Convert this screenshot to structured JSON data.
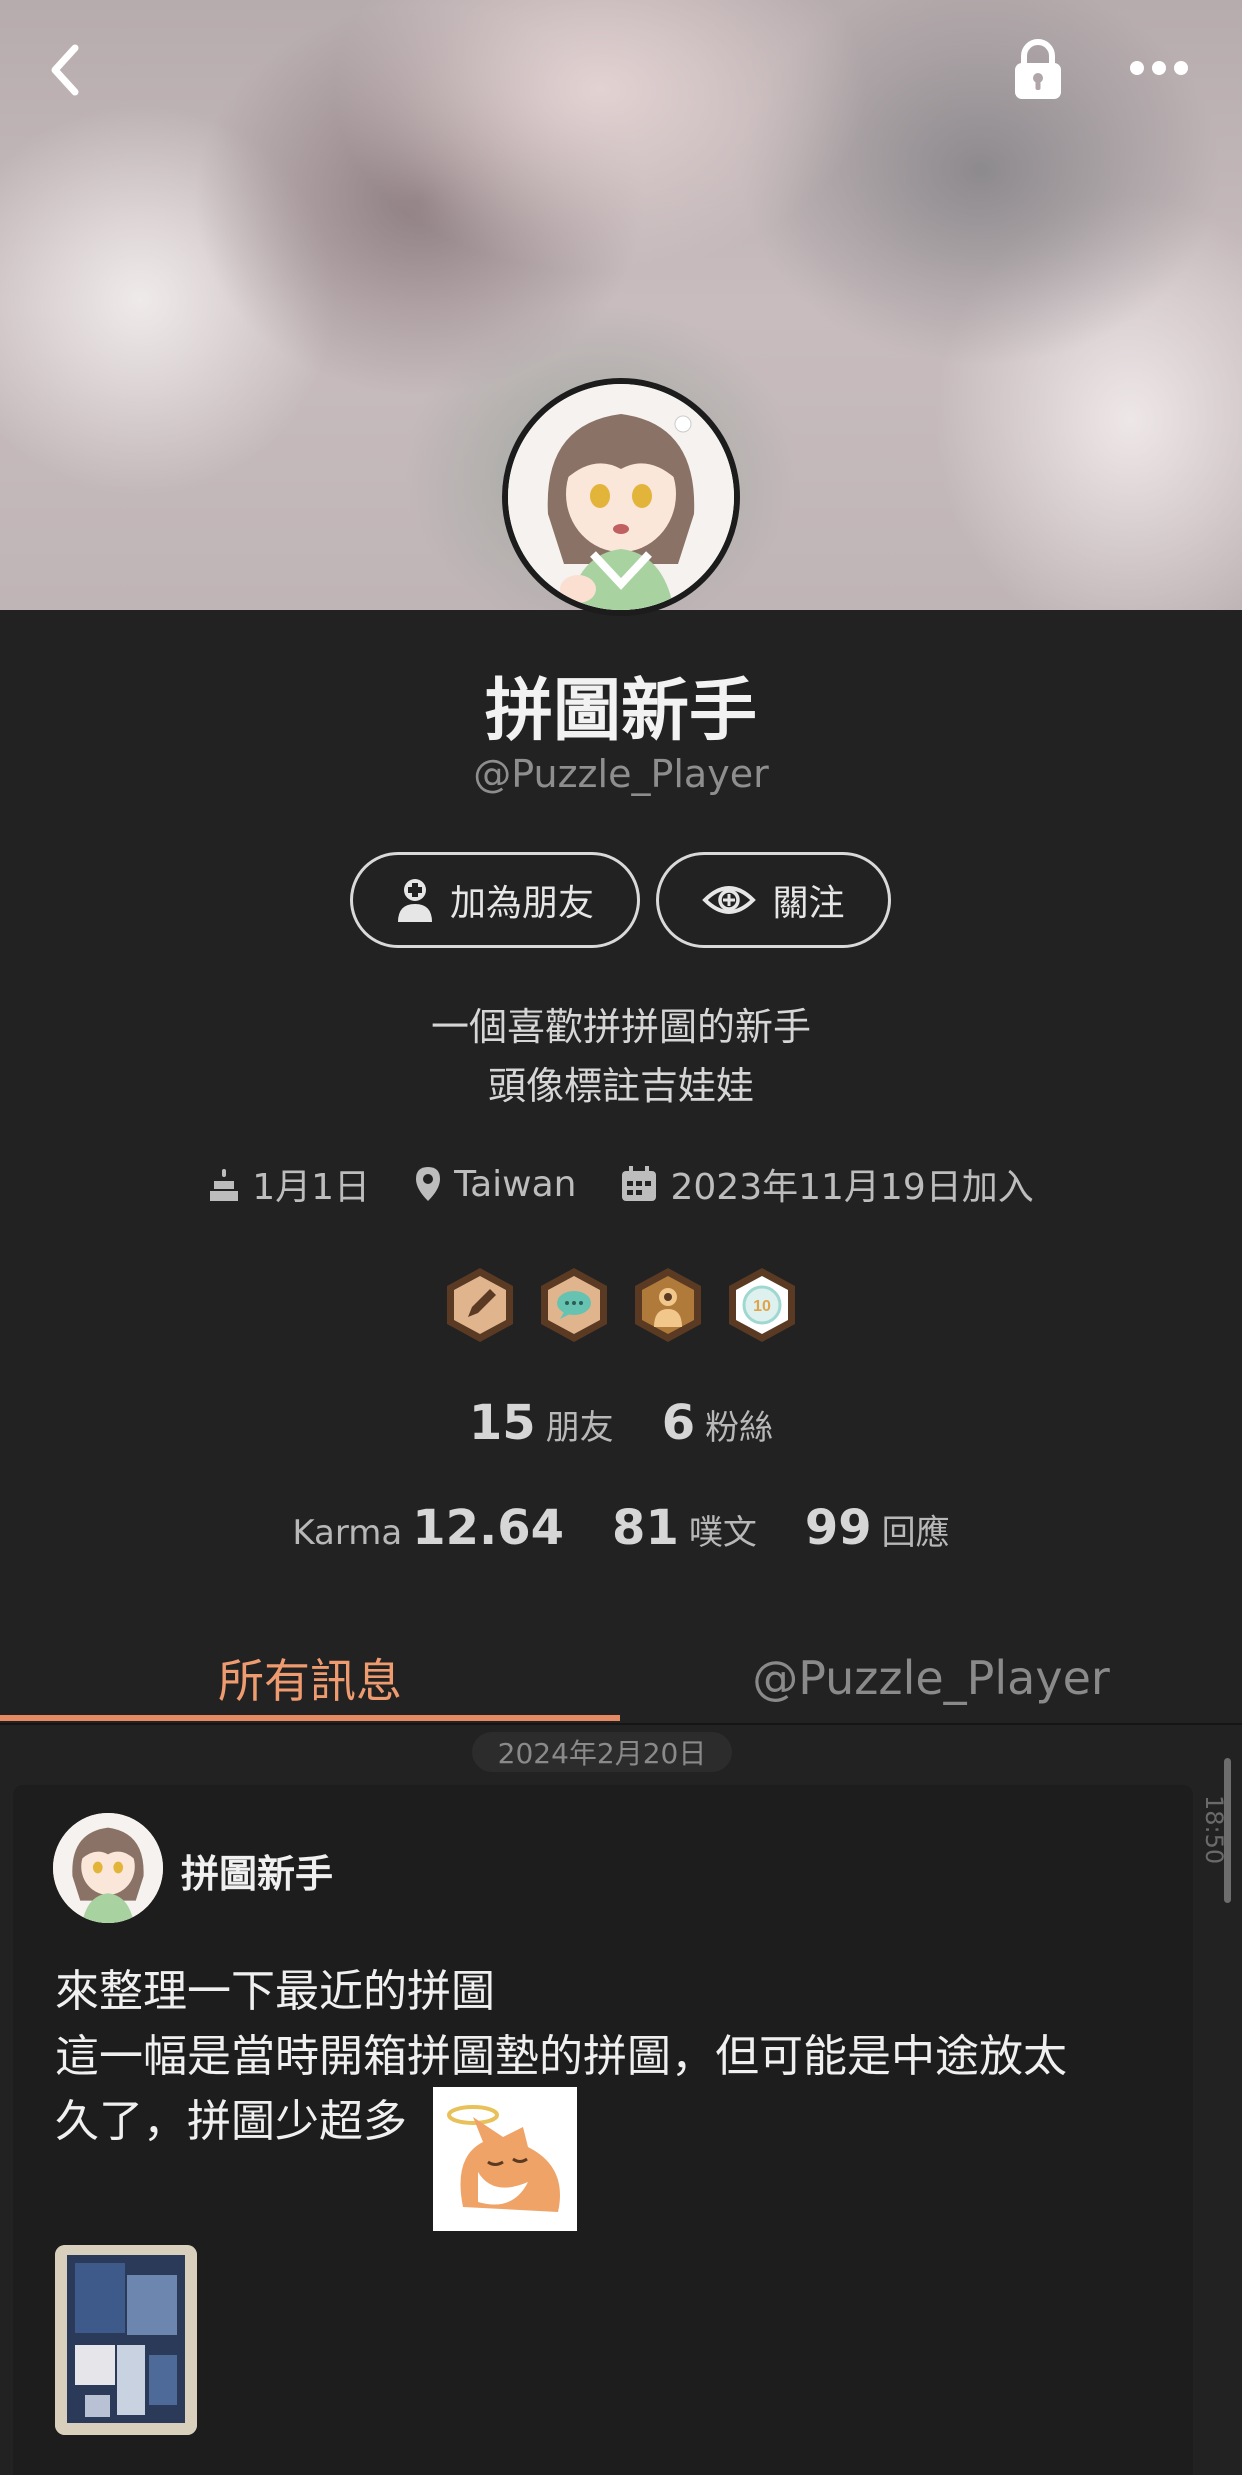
{
  "header": {
    "back_icon": "chevron-left-icon",
    "lock_icon": "lock-icon",
    "more_icon": "more-dots-icon"
  },
  "profile": {
    "display_name": "拼圖新手",
    "handle": "@Puzzle_Player",
    "add_friend_label": "加為朋友",
    "follow_label": "關注",
    "bio_line1": "一個喜歡拼拼圖的新手",
    "bio_line2": "頭像標註吉娃娃",
    "birthday": "1月1日",
    "location": "Taiwan",
    "joined": "2023年11月19日加入"
  },
  "badges": [
    {
      "name": "pencil-badge",
      "color": "#e0b58d"
    },
    {
      "name": "chat-badge",
      "color": "#66c3b2"
    },
    {
      "name": "mystery-person-badge",
      "color": "#f2c78c"
    },
    {
      "name": "ten-badge",
      "color": "#dff1ef",
      "text": "10"
    }
  ],
  "stats": {
    "friends_count": "15",
    "friends_label": "朋友",
    "fans_count": "6",
    "fans_label": "粉絲",
    "karma_label": "Karma",
    "karma_value": "12.64",
    "plurks_count": "81",
    "plurks_label": "噗文",
    "replies_count": "99",
    "replies_label": "回應"
  },
  "tabs": {
    "all": "所有訊息",
    "user": "@Puzzle_Player"
  },
  "timeline": {
    "date": "2024年2月20日",
    "scroll_time": "18:50"
  },
  "post": {
    "author": "拼圖新手",
    "line1": "來整理一下最近的拼圖",
    "line2": "這一幅是當時開箱拼圖墊的拼圖，但可能是中途放太",
    "line3": "久了，拼圖少超多"
  },
  "colors": {
    "accent": "#ee9b70",
    "background": "#222222",
    "card": "#1d1d1d"
  }
}
